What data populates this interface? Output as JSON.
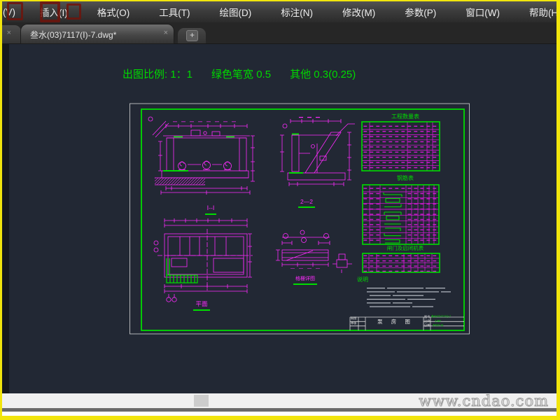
{
  "window": {
    "frame_color": "#f2e50c",
    "canvas_color": "#222834"
  },
  "menu_bar": {
    "items": [
      "(V)",
      "插入(I)",
      "格式(O)",
      "工具(T)",
      "绘图(D)",
      "标注(N)",
      "修改(M)",
      "参数(P)",
      "窗口(W)",
      "帮助(H)"
    ]
  },
  "tab_bar": {
    "clipped_tab_close": "×",
    "active_tab": {
      "title": "叁水(03)7117(Ⅰ)-7.dwg*",
      "close": "×"
    },
    "new_tab_label": "+"
  },
  "canvas": {
    "pen_note": {
      "scale": "出图比例: 1：1",
      "green_pen": "绿色笔宽 0.5",
      "other": "其他 0.3(0.25)"
    },
    "line_colors": {
      "primary": "#ff2bff",
      "accent_green": "#00dd00",
      "frame_white": "#d9d9d9"
    }
  },
  "sheet": {
    "view_labels": {
      "section_1": "Ⅰ--Ⅰ",
      "section_2": "2—2",
      "plan": "平面",
      "detail": "格栅详图"
    },
    "tables": {
      "quantities_title": "工程数量表",
      "rebar_title": "钢筋表",
      "materials_title": "闸门及启闭机表"
    },
    "notes": {
      "label": "说明"
    },
    "title_block": {
      "drawing_name": "泵 房 图",
      "left_rows": [
        "制图",
        "审核"
      ],
      "fields": [
        {
          "label": "图号",
          "value": "叁水(03)7117(Ⅰ)-7"
        },
        {
          "label": "比例",
          "value": "1:50"
        },
        {
          "label": "日期",
          "value": "2013.11"
        }
      ]
    }
  },
  "watermark": {
    "site": "www.cndao.com"
  }
}
